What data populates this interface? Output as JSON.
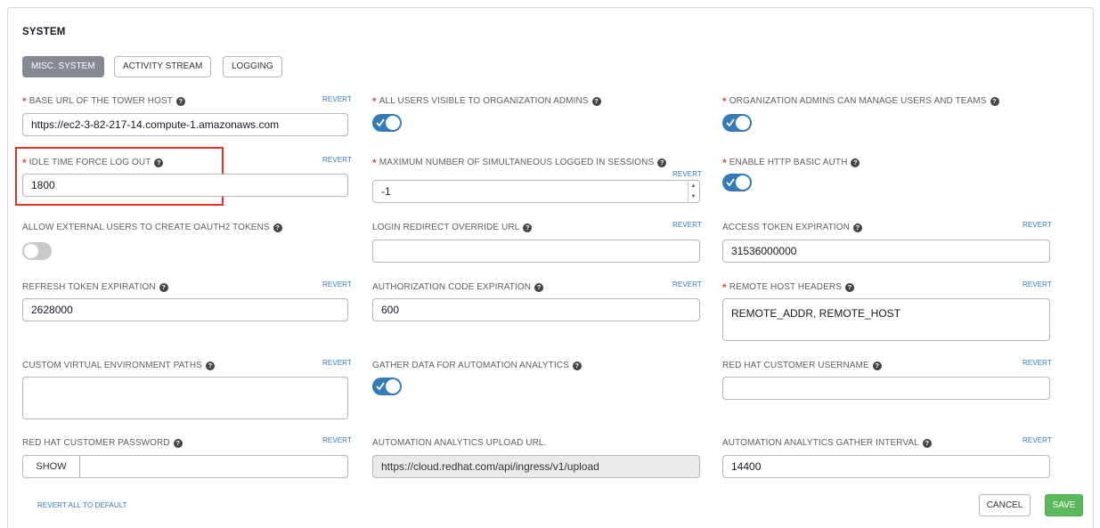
{
  "section": {
    "title": "SYSTEM"
  },
  "tabs": [
    {
      "label": "MISC. SYSTEM",
      "active": true
    },
    {
      "label": "ACTIVITY STREAM",
      "active": false
    },
    {
      "label": "LOGGING",
      "active": false
    }
  ],
  "help_glyph": "?",
  "required_mark": "*",
  "revert_label": "REVERT",
  "fields": {
    "base_url": {
      "label": "BASE URL OF THE TOWER HOST",
      "value": "https://ec2-3-82-217-14.compute-1.amazonaws.com"
    },
    "all_users_visible": {
      "label": "ALL USERS VISIBLE TO ORGANIZATION ADMINS",
      "checked": true
    },
    "org_admins_manage": {
      "label": "ORGANIZATION ADMINS CAN MANAGE USERS AND TEAMS",
      "checked": true
    },
    "idle_time": {
      "label": "IDLE TIME FORCE LOG OUT",
      "value": "1800"
    },
    "max_sessions": {
      "label": "MAXIMUM NUMBER OF SIMULTANEOUS LOGGED IN SESSIONS",
      "value": "-1"
    },
    "http_basic_auth": {
      "label": "ENABLE HTTP BASIC AUTH",
      "checked": true
    },
    "allow_external_oauth": {
      "label": "ALLOW EXTERNAL USERS TO CREATE OAUTH2 TOKENS",
      "checked": false
    },
    "login_redirect": {
      "label": "LOGIN REDIRECT OVERRIDE URL",
      "value": ""
    },
    "access_token_exp": {
      "label": "ACCESS TOKEN EXPIRATION",
      "value": "31536000000"
    },
    "refresh_token_exp": {
      "label": "REFRESH TOKEN EXPIRATION",
      "value": "2628000"
    },
    "auth_code_exp": {
      "label": "AUTHORIZATION CODE EXPIRATION",
      "value": "600"
    },
    "remote_host_headers": {
      "label": "REMOTE HOST HEADERS",
      "value": "REMOTE_ADDR, REMOTE_HOST"
    },
    "custom_venv_paths": {
      "label": "CUSTOM VIRTUAL ENVIRONMENT PATHS",
      "value": ""
    },
    "gather_analytics": {
      "label": "GATHER DATA FOR AUTOMATION ANALYTICS",
      "checked": true
    },
    "rh_username": {
      "label": "RED HAT CUSTOMER USERNAME",
      "value": ""
    },
    "rh_password": {
      "label": "RED HAT CUSTOMER PASSWORD",
      "show_label": "SHOW",
      "value": ""
    },
    "analytics_upload_url": {
      "label": "AUTOMATION ANALYTICS UPLOAD URL.",
      "value": "https://cloud.redhat.com/api/ingress/v1/upload"
    },
    "analytics_gather_interval": {
      "label": "AUTOMATION ANALYTICS GATHER INTERVAL",
      "value": "14400"
    }
  },
  "footer": {
    "revert_all": "REVERT ALL TO DEFAULT",
    "cancel": "CANCEL",
    "save": "SAVE"
  },
  "colors": {
    "accent": "#337ab7",
    "required": "#d9534f",
    "highlight": "#e0342a",
    "save": "#5cb85c"
  }
}
